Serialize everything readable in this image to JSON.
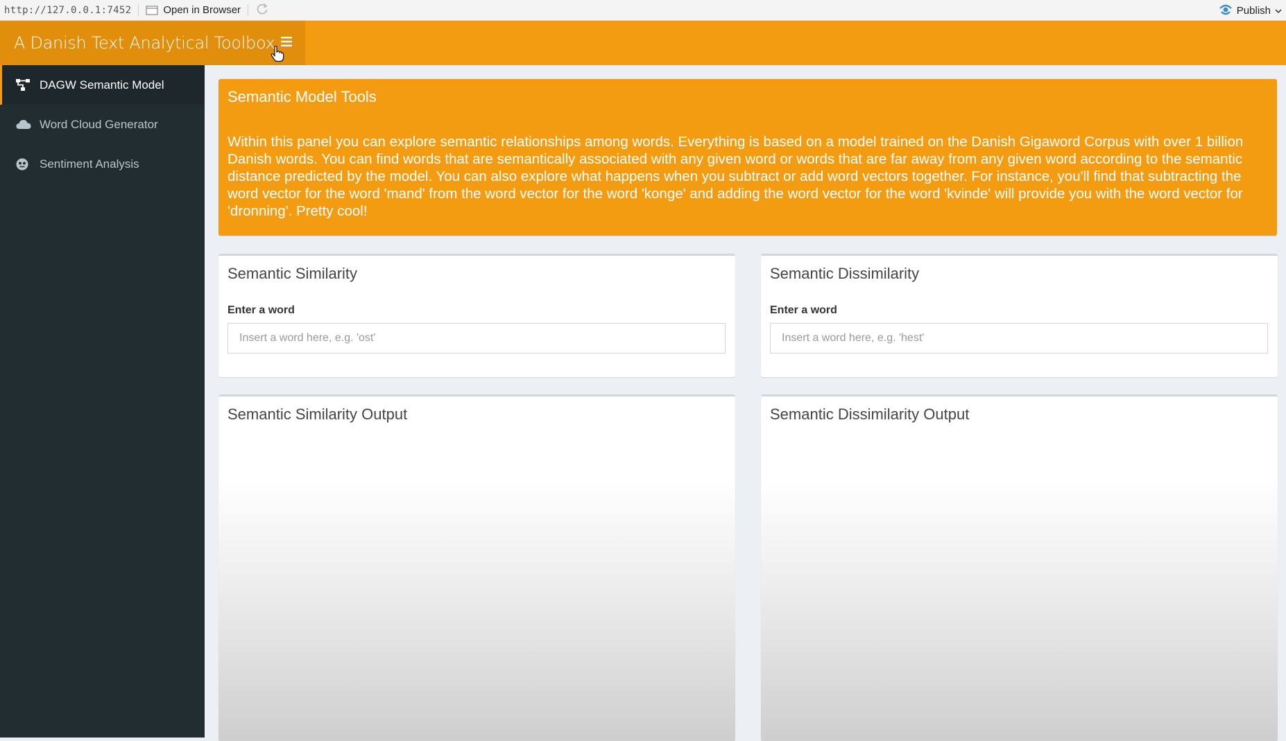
{
  "viewer": {
    "url": "http://127.0.0.1:7452",
    "open_in_browser": "Open in Browser",
    "publish": "Publish"
  },
  "header": {
    "title": "A Danish Text Analytical Toolbox",
    "accent_color": "#f39c12"
  },
  "sidebar": {
    "items": [
      {
        "label": "DAGW Semantic Model",
        "icon": "sitemap-icon",
        "active": true
      },
      {
        "label": "Word Cloud Generator",
        "icon": "cloud-icon",
        "active": false
      },
      {
        "label": "Sentiment Analysis",
        "icon": "face-icon",
        "active": false
      }
    ]
  },
  "info": {
    "title": "Semantic Model Tools",
    "text": "Within this panel you can explore semantic relationships among words. Everything is based on a model trained on the Danish Gigaword Corpus with over 1 billion Danish words. You can find words that are semantically associated with any given word or words that are far away from any given word according to the semantic distance predicted by the model. You can also explore what happens when you subtract or add word vectors together. For instance, you'll find that subtracting the word vector for the word 'mand' from the word vector for the word 'konge' and adding the word vector for the word 'kvinde' will provide you with the word vector for 'dronning'. Pretty cool!"
  },
  "similarity": {
    "title": "Semantic Similarity",
    "label": "Enter a word",
    "placeholder": "Insert a word here, e.g. 'ost'",
    "value": "",
    "output_title": "Semantic Similarity Output"
  },
  "dissimilarity": {
    "title": "Semantic Dissimilarity",
    "label": "Enter a word",
    "placeholder": "Insert a word here, e.g. 'hest'",
    "value": "",
    "output_title": "Semantic Dissimilarity Output"
  }
}
